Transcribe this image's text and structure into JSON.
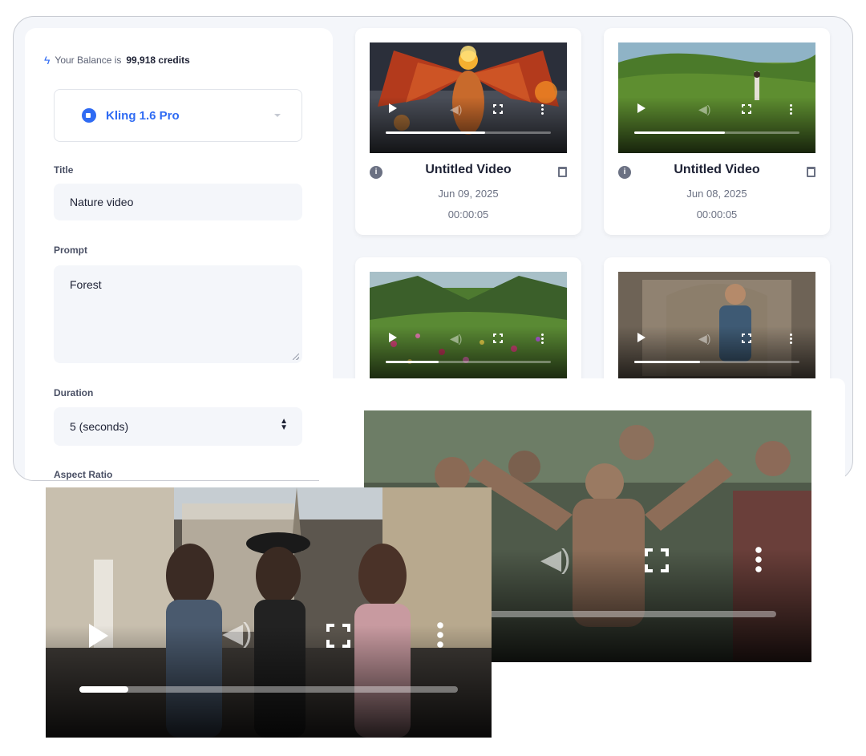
{
  "balance": {
    "prefix": "Your Balance is",
    "amount": "99,918 credits"
  },
  "model": {
    "selected": "Kling 1.6 Pro"
  },
  "form": {
    "title_label": "Title",
    "title_value": "Nature video",
    "prompt_label": "Prompt",
    "prompt_value": "Forest",
    "duration_label": "Duration",
    "duration_value": "5 (seconds)",
    "aspect_label": "Aspect Ratio"
  },
  "videos": [
    {
      "title": "Untitled Video",
      "date": "Jun 09, 2025",
      "duration": "00:00:05",
      "progress": 0.6,
      "scene": "dragon"
    },
    {
      "title": "Untitled Video",
      "date": "Jun 08, 2025",
      "duration": "00:00:05",
      "progress": 0.55,
      "scene": "meadow"
    },
    {
      "title": "",
      "date": "",
      "duration": "",
      "progress": 0.32,
      "scene": "flowers"
    },
    {
      "title": "",
      "date": "",
      "duration": "",
      "progress": 0.4,
      "scene": "man"
    }
  ],
  "large_players": [
    {
      "scene": "crowd",
      "progress": 0
    },
    {
      "scene": "street",
      "progress": 0.13
    }
  ],
  "colors": {
    "accent": "#2f6bf3",
    "text": "#1e2235",
    "muted": "#6b7183",
    "surface": "#f4f6fa"
  }
}
